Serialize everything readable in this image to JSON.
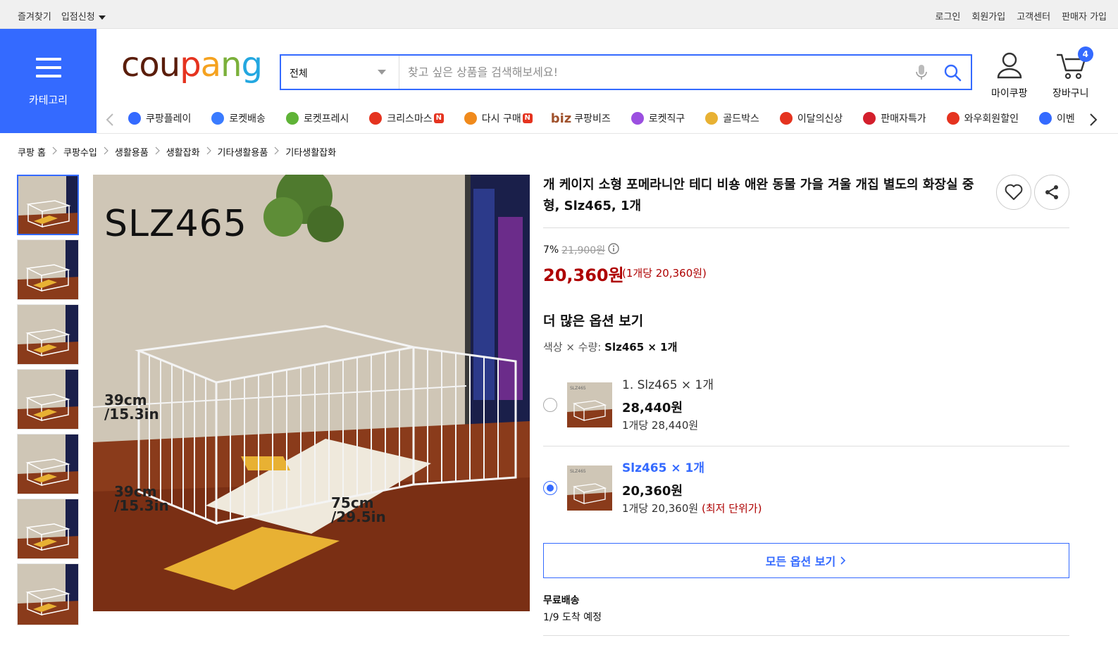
{
  "topbar": {
    "favorites": "즐겨찾기",
    "partner_apply": "입점신청",
    "login": "로그인",
    "signup": "회원가입",
    "support": "고객센터",
    "seller_signup": "판매자 가입"
  },
  "category": {
    "label": "카테고리"
  },
  "logo": {
    "p1": "cou",
    "p2": "p",
    "p3": "a",
    "p4": "n",
    "p5": "g"
  },
  "search": {
    "scope": "전체",
    "placeholder": "찾고 싶은 상품을 검색해보세요!"
  },
  "header": {
    "mycoupang": "마이쿠팡",
    "cart": "장바구니",
    "cart_count": "4"
  },
  "nav": {
    "items": [
      {
        "label": "쿠팡플레이",
        "icon": "play-icon"
      },
      {
        "label": "로켓배송",
        "icon": "rocket-icon"
      },
      {
        "label": "로켓프레시",
        "icon": "rocket-fresh-icon"
      },
      {
        "label": "크리스마스",
        "icon": "santa-icon",
        "badge": "N"
      },
      {
        "label": "다시 구매",
        "icon": "rebuy-icon",
        "badge": "N"
      },
      {
        "label": "쿠팡비즈",
        "icon": "biz-icon",
        "prefix": "biz"
      },
      {
        "label": "로켓직구",
        "icon": "rocket-global-icon"
      },
      {
        "label": "골드박스",
        "icon": "goldbox-icon"
      },
      {
        "label": "이달의신상",
        "icon": "new-bag-icon"
      },
      {
        "label": "판매자특가",
        "icon": "percent-icon"
      },
      {
        "label": "와우회원할인",
        "icon": "wow-icon"
      },
      {
        "label": "이벤",
        "icon": "event-icon"
      }
    ]
  },
  "breadcrumb": [
    "쿠팡 홈",
    "쿠팡수입",
    "생활용품",
    "생활잡화",
    "기타생활용품",
    "기타생활잡화"
  ],
  "image": {
    "model": "SLZ465",
    "dim1": "39cm\n/15.3in",
    "dim2": "39cm\n/15.3in",
    "dim3": "75cm\n/29.5in",
    "thumb_label": "SLZ465"
  },
  "product": {
    "title": "개 케이지 소형 포메라니안 테디 비숑 애완 동물 가을 겨울 개집 별도의 화장실 중형, Slz465, 1개",
    "discount": "7%",
    "original_price": "21,900원",
    "price": "20,360원",
    "unit_price": "(1개당 20,360원)",
    "more_options_title": "더 많은 옵션 보기",
    "selection_label": "색상 × 수량: ",
    "selection_value": "Slz465 × 1개",
    "options": [
      {
        "name": "1. Slz465 × 1개",
        "price": "28,440원",
        "per_unit": "1개당 28,440원",
        "lowest": "",
        "selected": false
      },
      {
        "name": "Slz465 × 1개",
        "price": "20,360원",
        "per_unit": "1개당 20,360원",
        "lowest": "(최저 단위가)",
        "selected": true
      }
    ],
    "all_options_button": "모든 옵션 보기",
    "shipping": "무료배송",
    "arrival": "1/9 도착 예정"
  }
}
